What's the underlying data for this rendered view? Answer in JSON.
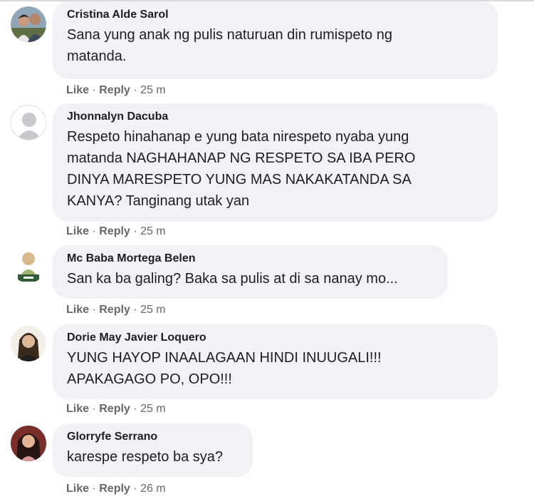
{
  "actions": {
    "like": "Like",
    "reply": "Reply",
    "sep": "·"
  },
  "comments": [
    {
      "author": "Cristina Alde Sarol",
      "text": "Sana yung anak ng pulis naturuan din rumispeto ng\nmatanda.",
      "time": "25 m"
    },
    {
      "author": "Jhonnalyn Dacuba",
      "text": "Respeto hinahanap e yung bata nirespeto nyaba yung\nmatanda NAGHAHANAP NG RESPETO SA IBA PERO\nDINYA MARESPETO YUNG MAS NAKAKATANDA SA\nKANYA? Tanginang utak yan",
      "time": "25 m"
    },
    {
      "author": "Mc Baba Mortega Belen",
      "text": "San ka ba galing? Baka sa pulis at di sa nanay mo...",
      "time": "25 m"
    },
    {
      "author": "Dorie May Javier Loquero",
      "text": "YUNG HAYOP INAALAGAAN HINDI INUUGALI!!!\nAPAKAGAGO PO, OPO!!!",
      "time": "25 m"
    },
    {
      "author": "Glorryfe Serrano",
      "text": "karespe respeto ba sya?",
      "time": "26 m"
    }
  ]
}
